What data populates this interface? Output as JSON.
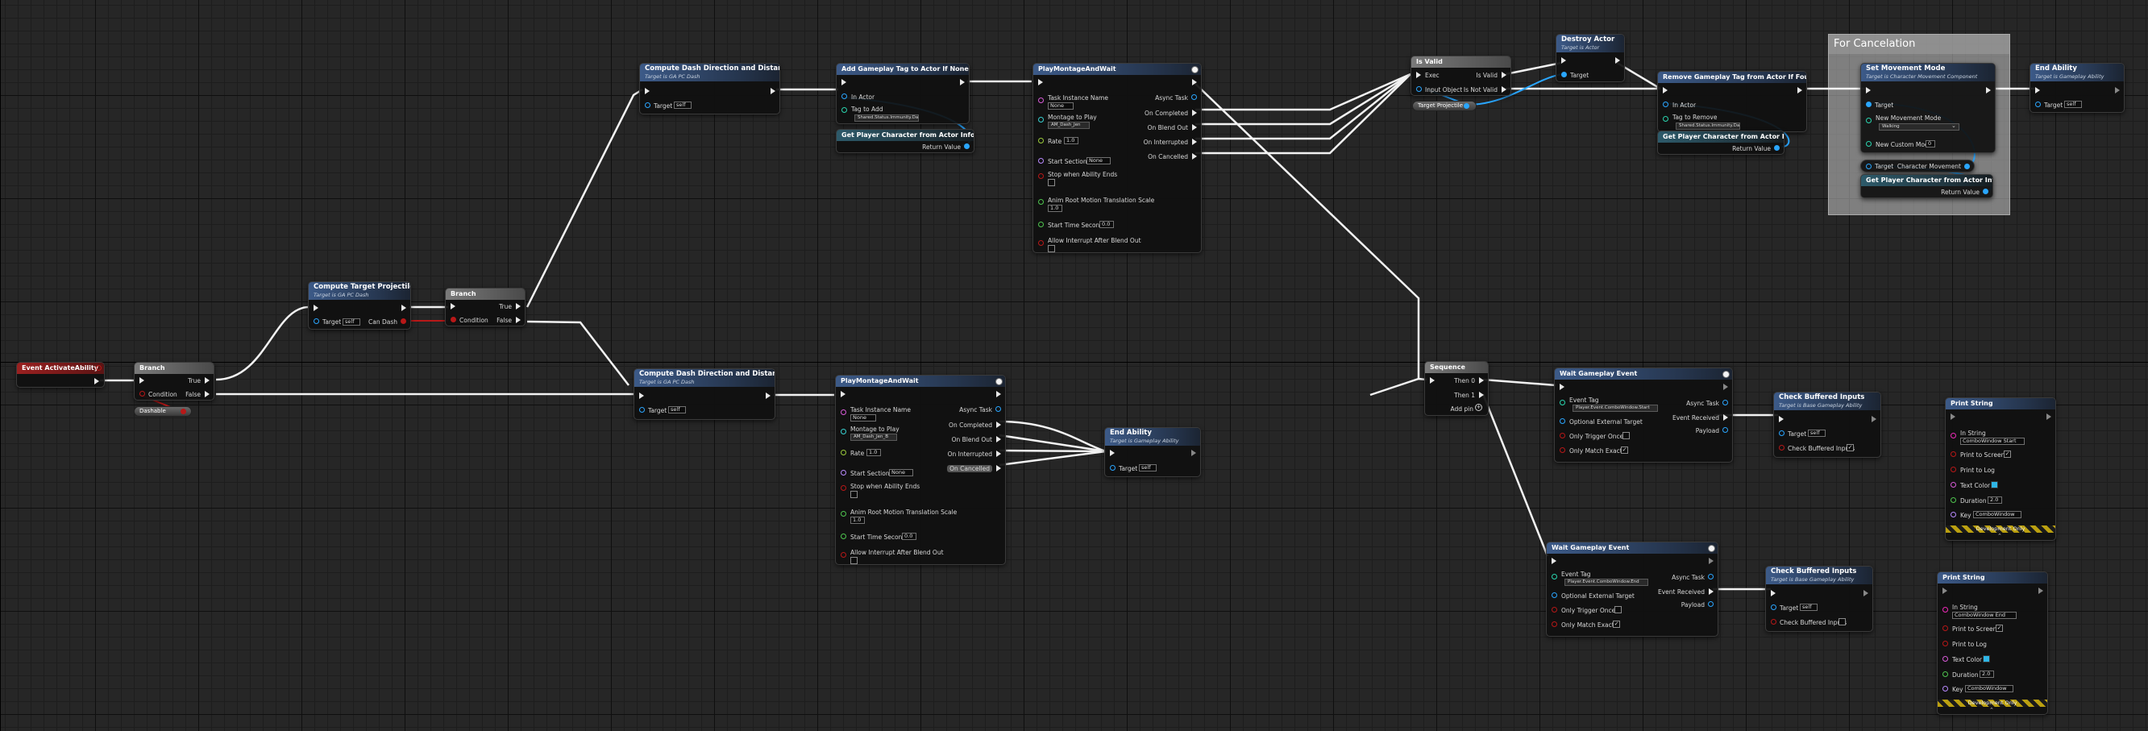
{
  "comment": {
    "title": "For Cancelation"
  },
  "nodes": {
    "event_activate": {
      "title": "Event ActivateAbility"
    },
    "branch1": {
      "title": "Branch",
      "true": "True",
      "false": "False",
      "condition": "Condition"
    },
    "dashable": {
      "label": "Dashable"
    },
    "compute_target": {
      "title": "Compute Target Projectile",
      "sub": "Target is GA PC Dash",
      "target": "Target",
      "self": "self",
      "can_dash": "Can Dash"
    },
    "branch2": {
      "title": "Branch",
      "true": "True",
      "false": "False",
      "condition": "Condition"
    },
    "cdd_top": {
      "title": "Compute Dash Direction and Distance",
      "sub": "Target is GA PC Dash",
      "target": "Target",
      "self": "self"
    },
    "cdd_bot": {
      "title": "Compute Dash Direction and Distance",
      "sub": "Target is GA PC Dash",
      "target": "Target",
      "self": "self"
    },
    "add_tag": {
      "title": "Add Gameplay Tag to Actor If None",
      "in_actor": "In Actor",
      "tag_to_add": "Tag to Add",
      "tag_value": "Shared.Status.Immunity.Dash"
    },
    "get_player_char1": {
      "title": "Get Player Character from Actor Info",
      "return": "Return Value"
    },
    "play_top": {
      "title": "PlayMontageAndWait",
      "async": "Async Task",
      "task_instance": "Task Instance Name",
      "task_val": "None",
      "montage": "Montage to Play",
      "montage_val": "AM_Dash_Jen",
      "rate": "Rate",
      "rate_val": "1.0",
      "start_section": "Start Section",
      "start_val": "None",
      "stop": "Stop when Ability Ends",
      "anim_root": "Anim Root Motion Translation Scale",
      "anim_val": "1.0",
      "start_time": "Start Time Seconds",
      "start_time_val": "0.0",
      "allow": "Allow Interrupt After Blend Out",
      "on_completed": "On Completed",
      "on_blend": "On Blend Out",
      "on_interrupted": "On Interrupted",
      "on_cancelled": "On Cancelled"
    },
    "play_bot": {
      "title": "PlayMontageAndWait",
      "async": "Async Task",
      "task_instance": "Task Instance Name",
      "task_val": "None",
      "montage": "Montage to Play",
      "montage_val": "AM_Dash_Jen_B",
      "rate": "Rate",
      "rate_val": "1.0",
      "start_section": "Start Section",
      "start_val": "None",
      "stop": "Stop when Ability Ends",
      "anim_root": "Anim Root Motion Translation Scale",
      "anim_val": "1.0",
      "start_time": "Start Time Seconds",
      "start_time_val": "0.0",
      "allow": "Allow Interrupt After Blend Out",
      "on_completed": "On Completed",
      "on_blend": "On Blend Out",
      "on_interrupted": "On Interrupted",
      "on_cancelled": "On Cancelled"
    },
    "end_ability_mid": {
      "title": "End Ability",
      "sub": "Target is Gameplay Ability",
      "target": "Target",
      "self": "self"
    },
    "is_valid": {
      "title": "Is Valid",
      "exec": "Exec",
      "is_valid": "Is Valid",
      "input_object": "Input Object",
      "is_not_valid": "Is Not Valid"
    },
    "target_projectile": {
      "label": "Target Projectile"
    },
    "destroy_actor": {
      "title": "Destroy Actor",
      "sub": "Target is Actor",
      "target": "Target"
    },
    "remove_tag": {
      "title": "Remove Gameplay Tag from Actor If Found",
      "in_actor": "In Actor",
      "tag_to_remove": "Tag to Remove",
      "tag_value": "Shared.Status.Immunity.Dash"
    },
    "get_player_char2": {
      "title": "Get Player Character from Actor Info",
      "return": "Return Value"
    },
    "set_movement": {
      "title": "Set Movement Mode",
      "sub": "Target is Character Movement Component",
      "target": "Target",
      "new_mode": "New Movement Mode",
      "mode_val": "Walking",
      "custom": "New Custom Mode",
      "custom_val": "0"
    },
    "char_movement": {
      "target": "Target",
      "label": "Character Movement"
    },
    "get_player_char3": {
      "title": "Get Player Character from Actor Info",
      "return": "Return Value"
    },
    "end_ability_top": {
      "title": "End Ability",
      "sub": "Target is Gameplay Ability",
      "target": "Target",
      "self": "self"
    },
    "sequence": {
      "title": "Sequence",
      "then0": "Then 0",
      "then1": "Then 1",
      "add_pin": "Add pin"
    },
    "wait_event1": {
      "title": "Wait Gameplay Event",
      "event_tag": "Event Tag",
      "tag_val": "Player.Event.ComboWindow.Start",
      "async": "Async Task",
      "event_received": "Event Received",
      "optional": "Optional External Target",
      "payload": "Payload",
      "trigger_once": "Only Trigger Once",
      "exact": "Only Match Exact"
    },
    "wait_event2": {
      "title": "Wait Gameplay Event",
      "event_tag": "Event Tag",
      "tag_val": "Player.Event.ComboWindow.End",
      "async": "Async Task",
      "event_received": "Event Received",
      "optional": "Optional External Target",
      "payload": "Payload",
      "trigger_once": "Only Trigger Once",
      "exact": "Only Match Exact"
    },
    "check_buf1": {
      "title": "Check Buffered Inputs",
      "sub": "Target is Base Gameplay Ability",
      "target": "Target",
      "self": "self",
      "label": "Check Buffered Inputs"
    },
    "check_buf2": {
      "title": "Check Buffered Inputs",
      "sub": "Target is Base Gameplay Ability",
      "target": "Target",
      "self": "self",
      "label": "Check Buffered Inputs"
    },
    "print1": {
      "title": "Print String",
      "in_string": "In String",
      "in_val": "ComboWindow Start",
      "screen": "Print to Screen",
      "log": "Print to Log",
      "color": "Text Color",
      "duration": "Duration",
      "duration_val": "2.0",
      "key": "Key",
      "key_val": "ComboWindow",
      "dev": "Development Only"
    },
    "print2": {
      "title": "Print String",
      "in_string": "In String",
      "in_val": "ComboWindow End",
      "screen": "Print to Screen",
      "log": "Print to Log",
      "color": "Text Color",
      "duration": "Duration",
      "duration_val": "2.0",
      "key": "Key",
      "key_val": "ComboWindow",
      "dev": "Development Only"
    }
  }
}
